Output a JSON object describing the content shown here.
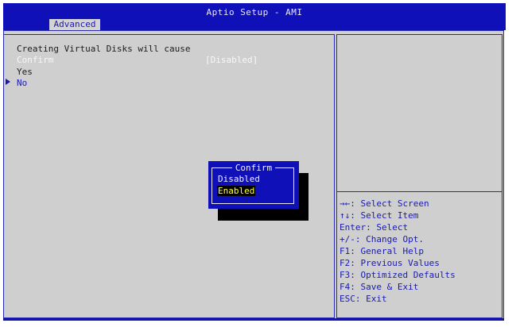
{
  "header": {
    "title": "Aptio Setup - AMI",
    "tab": "Advanced"
  },
  "main": {
    "description": "Creating Virtual Disks will cause",
    "confirm_label": "Confirm",
    "confirm_value": "[Disabled]",
    "options": [
      "Yes",
      "No"
    ]
  },
  "popup": {
    "title": "Confirm",
    "options": [
      "Disabled",
      "Enabled"
    ],
    "selected": "Enabled"
  },
  "help": {
    "items": [
      "→←: Select Screen",
      "↑↓: Select Item",
      "Enter: Select",
      "+/-: Change Opt.",
      "F1: General Help",
      "F2: Previous Values",
      "F3: Optimized Defaults",
      "F4: Save & Exit",
      "ESC: Exit"
    ]
  },
  "colors": {
    "bar_blue": "#1010b8",
    "panel_grey": "#cfcfcf",
    "highlight_yellow": "#ffff40"
  }
}
